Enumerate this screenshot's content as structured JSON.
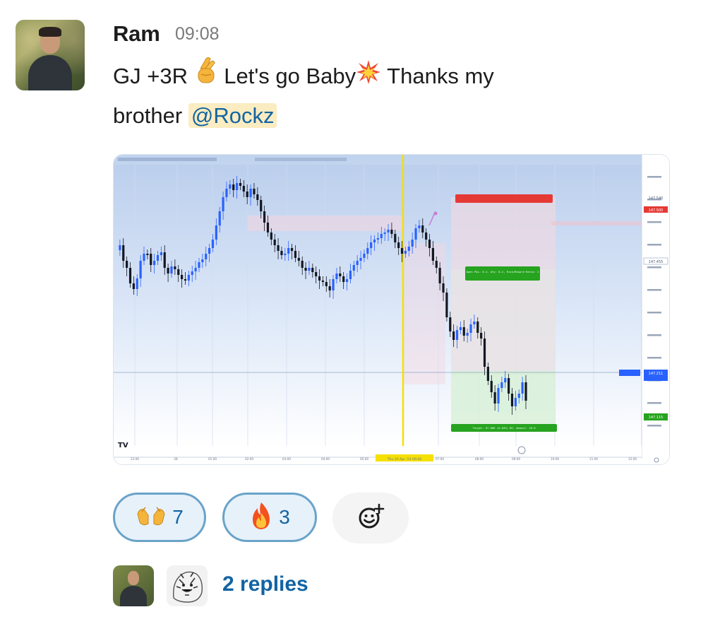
{
  "message": {
    "sender": "Ram",
    "time": "09:08",
    "line1_a": "GJ +3R",
    "line1_b": "Let's go Baby",
    "line1_c": "Thanks my",
    "line2_a": "brother",
    "mention": "@Rockz",
    "emojis": [
      "crossed-fingers-icon",
      "collision-icon"
    ]
  },
  "chart": {
    "x_ticks": [
      "23:00",
      "28",
      "01:00",
      "02:00",
      "03:00",
      "04:00",
      "05:00",
      "Thu 20 Apr '23  06:00",
      "07:00",
      "08:00",
      "09:00",
      "10:00",
      "11:00",
      "12:00"
    ],
    "position_labels": {
      "target": "Target: 67.000 (0.04%) 89, Amount: 20.8",
      "open": "Open P&L: 6.4, Qty: 8.2, Risk/Reward Ratio: 2"
    },
    "price_badges": [
      "147.540",
      "147.500",
      "147.455",
      "147.211",
      "147.115"
    ],
    "logo": "TV",
    "colors": {
      "candle_up": "#2962ff",
      "candle_down": "#131722",
      "stop": "#e53935",
      "target": "#26a31f",
      "cursor": "#f5e000"
    }
  },
  "reactions": [
    {
      "icon": "raised-hands-icon",
      "count": "7"
    },
    {
      "icon": "fire-icon",
      "count": "3"
    }
  ],
  "add_reaction_icon": "add-reaction-icon",
  "thread": {
    "replies": "2 replies"
  }
}
